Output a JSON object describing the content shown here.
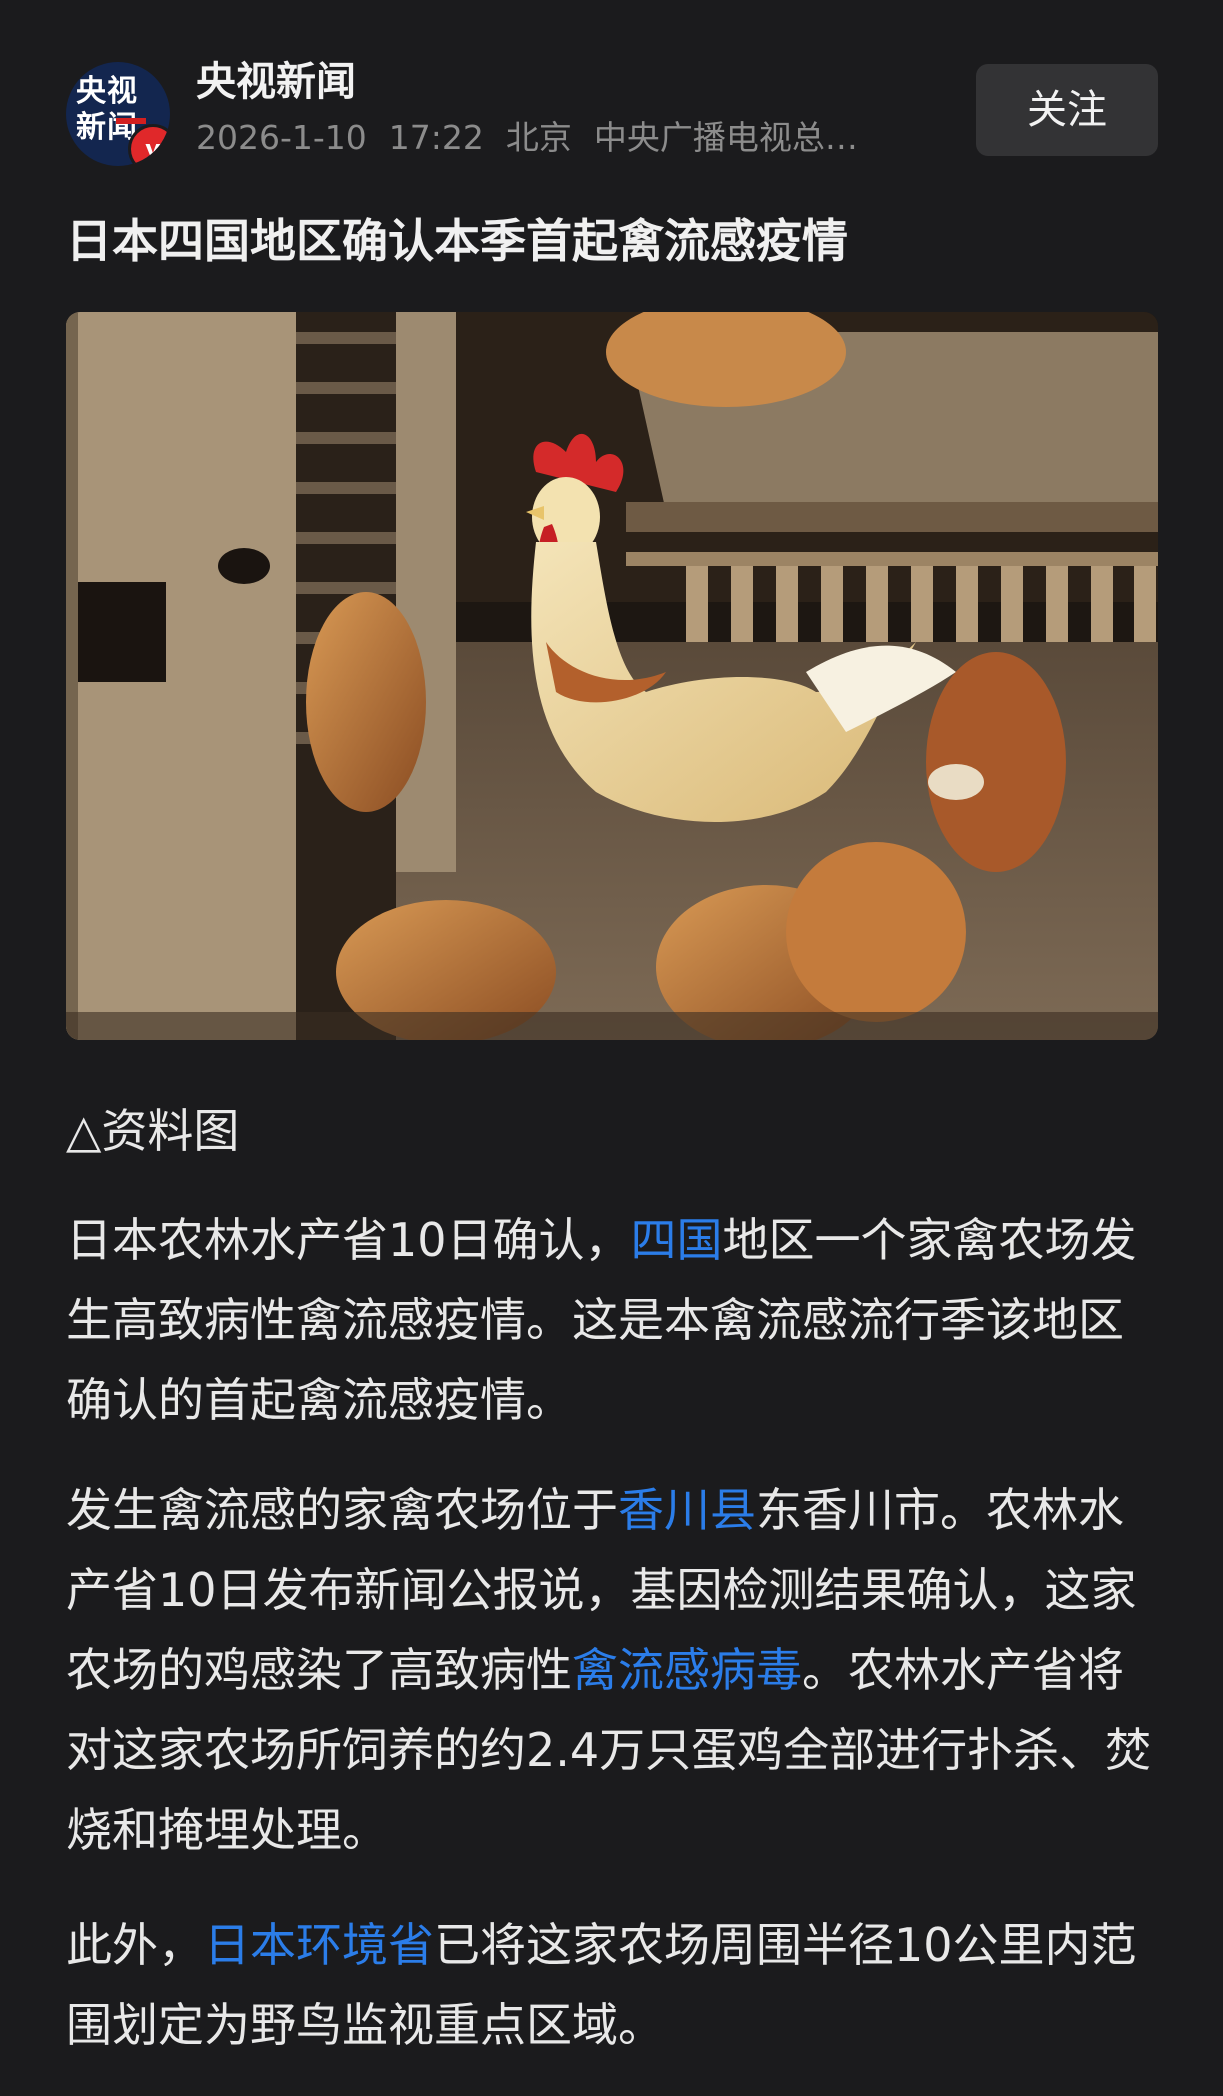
{
  "header": {
    "avatar_text": "央视新闻",
    "verified_badge": "v",
    "source_name": "央视新闻",
    "date": "2026-1-10",
    "time": "17:22",
    "location": "北京",
    "publisher": "中央广播电视总…",
    "follow_label": "关注"
  },
  "article": {
    "title": "日本四国地区确认本季首起禽流感疫情",
    "image_caption": "△资料图",
    "paragraphs": [
      {
        "segments": [
          {
            "text": "日本农林水产省10日确认，",
            "link": false
          },
          {
            "text": "四国",
            "link": true
          },
          {
            "text": "地区一个家禽农场发生高致病性禽流感疫情。这是本禽流感流行季该地区确认的首起禽流感疫情。",
            "link": false
          }
        ]
      },
      {
        "segments": [
          {
            "text": "发生禽流感的家禽农场位于",
            "link": false
          },
          {
            "text": "香川县",
            "link": true
          },
          {
            "text": "东香川市。农林水产省10日发布新闻公报说，基因检测结果确认，这家农场的鸡感染了高致病性",
            "link": false
          },
          {
            "text": "禽流感病毒",
            "link": true
          },
          {
            "text": "。农林水产省将对这家农场所饲养的约2.4万只蛋鸡全部进行扑杀、焚烧和掩埋处理。",
            "link": false
          }
        ]
      },
      {
        "segments": [
          {
            "text": "此外，",
            "link": false
          },
          {
            "text": "日本环境省",
            "link": true
          },
          {
            "text": "已将这家农场周围半径10公里内范围划定为野鸟监视重点区域。",
            "link": false
          }
        ]
      }
    ]
  },
  "colors": {
    "background": "#1b1b1d",
    "text": "#e8e8e8",
    "meta": "#8c8c8c",
    "link": "#2b7de9",
    "follow_button_bg": "#333335",
    "badge_red": "#e0282a"
  }
}
